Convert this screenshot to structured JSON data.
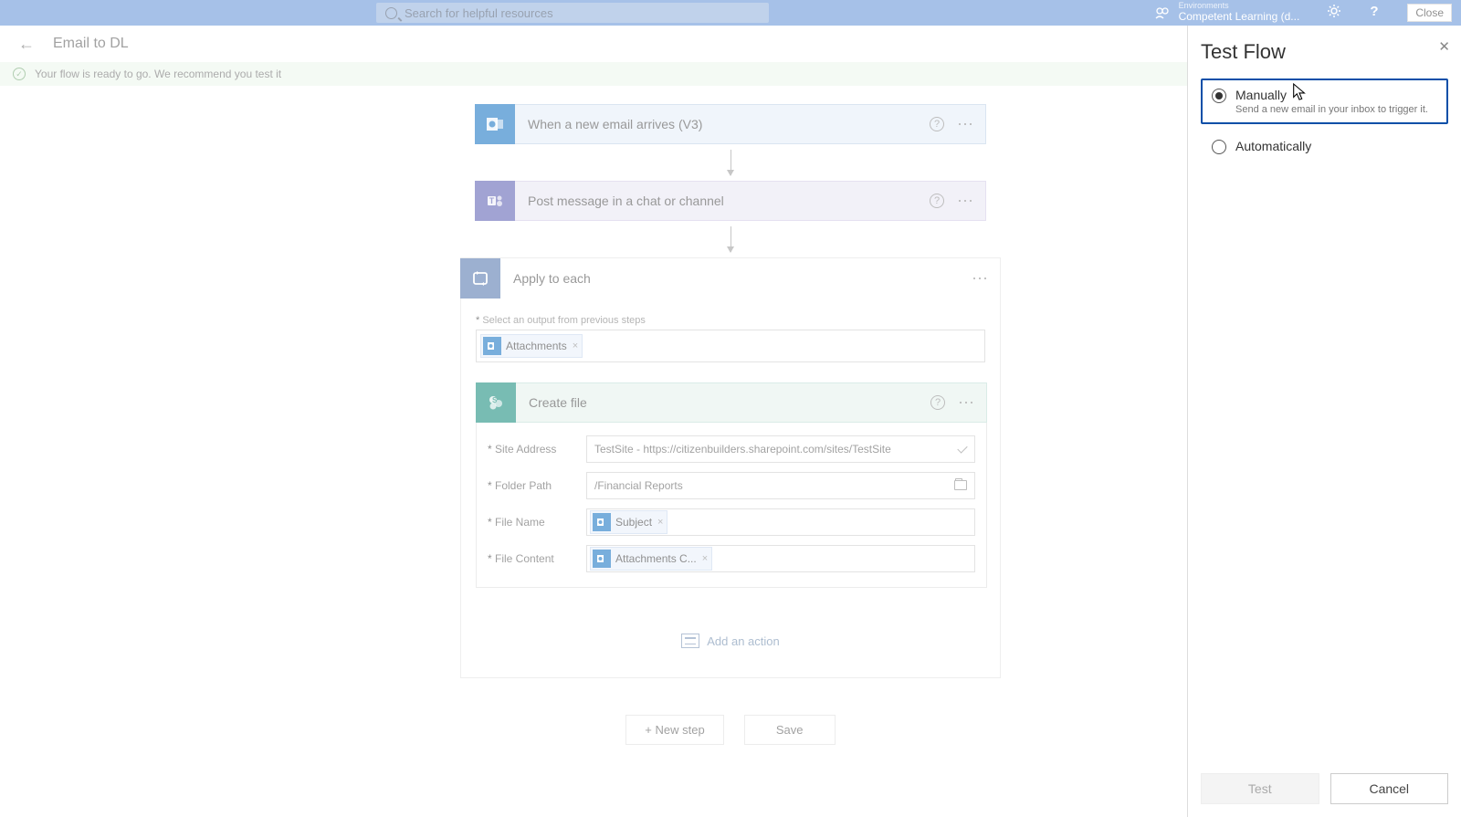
{
  "header": {
    "search_placeholder": "Search for helpful resources",
    "env_label": "Environments",
    "env_name": "Competent Learning (d...",
    "close_tooltip": "Close"
  },
  "page": {
    "title": "Email to DL",
    "notification": "Your flow is ready to go. We recommend you test it"
  },
  "flow": {
    "trigger_title": "When a new email arrives (V3)",
    "teams_title": "Post message in a chat or channel",
    "apply_title": "Apply to each",
    "apply_field_label": "Select an output from previous steps",
    "attachments_token": "Attachments",
    "create_file_title": "Create file",
    "fields": {
      "site_address_label": "Site Address",
      "site_address_value": "TestSite - https://citizenbuilders.sharepoint.com/sites/TestSite",
      "folder_path_label": "Folder Path",
      "folder_path_value": "/Financial Reports",
      "file_name_label": "File Name",
      "file_name_token": "Subject",
      "file_content_label": "File Content",
      "file_content_token": "Attachments C..."
    },
    "add_action": "Add an action"
  },
  "buttons": {
    "new_step": "+ New step",
    "save": "Save"
  },
  "panel": {
    "title": "Test Flow",
    "manual_label": "Manually",
    "manual_sub": "Send a new email in your inbox to trigger it.",
    "auto_label": "Automatically",
    "test": "Test",
    "cancel": "Cancel"
  }
}
